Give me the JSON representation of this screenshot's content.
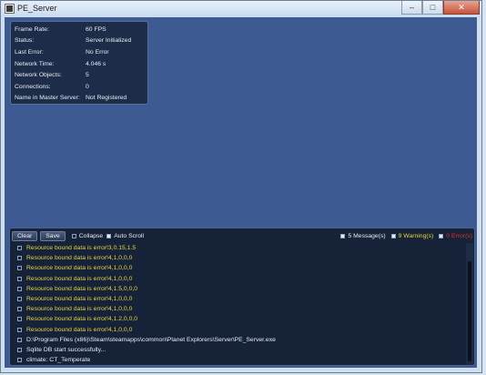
{
  "window": {
    "title": "PE_Server"
  },
  "stats": [
    {
      "label": "Frame Rate:",
      "value": "60 FPS"
    },
    {
      "label": "Status:",
      "value": "Server Initialized"
    },
    {
      "label": "Last Error:",
      "value": "No Error"
    },
    {
      "label": "Network Time:",
      "value": "4.046 s"
    },
    {
      "label": "Network Objects:",
      "value": "5"
    },
    {
      "label": "Connections:",
      "value": "0"
    },
    {
      "label": "Name in Master Server:",
      "value": "Not Registered"
    }
  ],
  "console": {
    "clear_label": "Clear",
    "save_label": "Save",
    "collapse_label": "Collapse",
    "collapse_checked": false,
    "auto_scroll_label": "Auto Scroll",
    "auto_scroll_checked": true,
    "messages_label": "5 Message(s)",
    "warnings_label": "9 Warning(s)",
    "errors_label": "0 Error(s)",
    "colors": {
      "warning": "#e4d63c",
      "error": "#e0312a",
      "message": "#e8ecf4"
    },
    "log": [
      {
        "type": "warning",
        "text": "Resource bound data is error!3,0.15,1.5"
      },
      {
        "type": "warning",
        "text": "Resource bound data is error!4,1,0,0,0"
      },
      {
        "type": "warning",
        "text": "Resource bound data is error!4,1,0,0,0"
      },
      {
        "type": "warning",
        "text": "Resource bound data is error!4,1,0,0,0"
      },
      {
        "type": "warning",
        "text": "Resource bound data is error!4,1.5,0,0,0"
      },
      {
        "type": "warning",
        "text": "Resource bound data is error!4,1,0,0,0"
      },
      {
        "type": "warning",
        "text": "Resource bound data is error!4,1,0,0,0"
      },
      {
        "type": "warning",
        "text": "Resource bound data is error!4,1.2,0,0,0"
      },
      {
        "type": "warning",
        "text": "Resource bound data is error!4,1,0,0,0"
      },
      {
        "type": "message",
        "text": "D:\\Program Files (x86)\\Steam\\steamapps\\common\\Planet Explorers\\Server\\PE_Server.exe"
      },
      {
        "type": "message",
        "text": "Sqlite DB start successfully..."
      },
      {
        "type": "message",
        "text": "climate: CT_Temperate"
      }
    ]
  }
}
